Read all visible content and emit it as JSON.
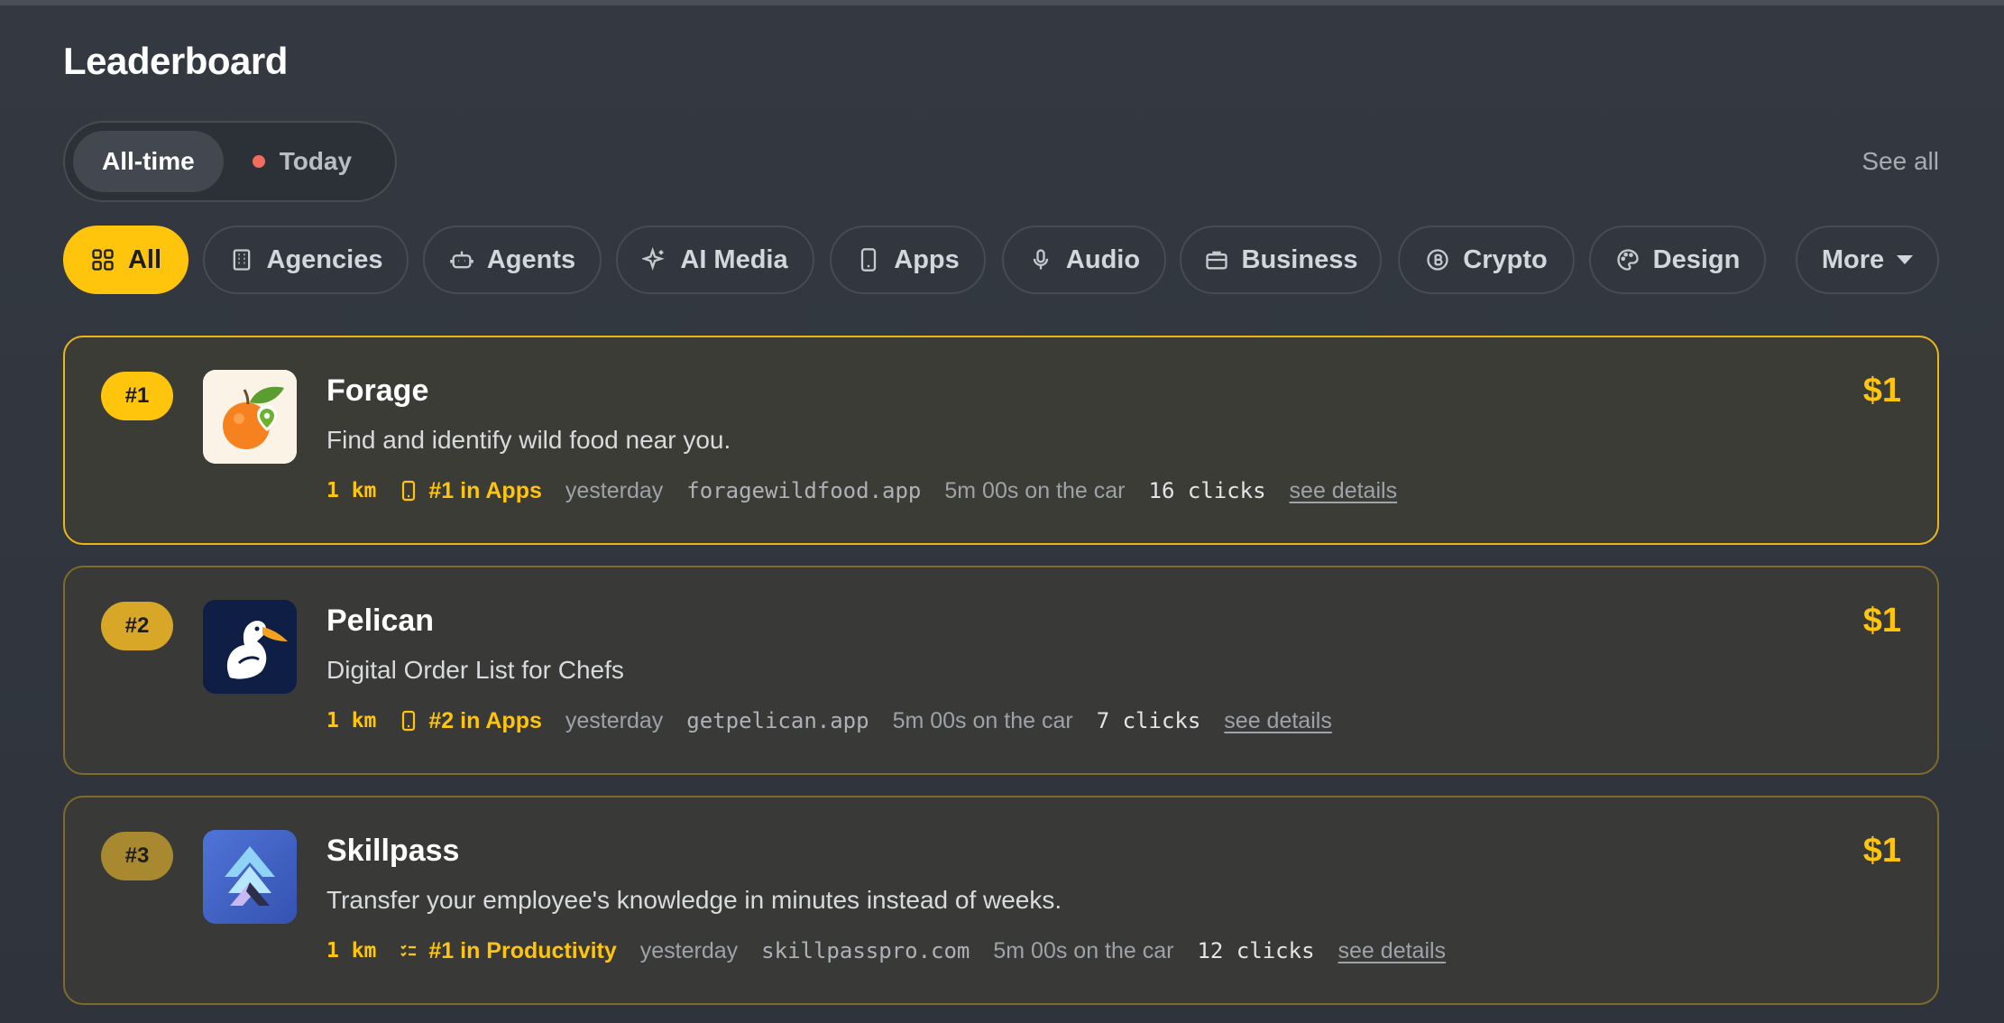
{
  "header": {
    "title": "Leaderboard",
    "see_all": "See all"
  },
  "timeframe": {
    "options": [
      "All-time",
      "Today"
    ],
    "selected": "All-time"
  },
  "categories": {
    "items": [
      {
        "label": "All",
        "icon": "grid-icon"
      },
      {
        "label": "Agencies",
        "icon": "building-icon"
      },
      {
        "label": "Agents",
        "icon": "robot-icon"
      },
      {
        "label": "AI Media",
        "icon": "sparkles-icon"
      },
      {
        "label": "Apps",
        "icon": "phone-icon"
      },
      {
        "label": "Audio",
        "icon": "microphone-icon"
      },
      {
        "label": "Business",
        "icon": "briefcase-icon"
      },
      {
        "label": "Crypto",
        "icon": "bitcoin-icon"
      },
      {
        "label": "Design",
        "icon": "palette-icon"
      }
    ],
    "more_label": "More",
    "selected": "All"
  },
  "entries": [
    {
      "rank": "#1",
      "name": "Forage",
      "description": "Find and identify wild food near you.",
      "distance": "1 km",
      "category_rank": "#1 in Apps",
      "category_icon": "phone-icon",
      "when": "yesterday",
      "domain": "foragewildfood.app",
      "duration": "5m 00s on the car",
      "clicks": "16 clicks",
      "details": "see details",
      "price": "$1",
      "logo": "orange-logo",
      "rank_color": "#ffc40c"
    },
    {
      "rank": "#2",
      "name": "Pelican",
      "description": "Digital Order List for Chefs",
      "distance": "1 km",
      "category_rank": "#2 in Apps",
      "category_icon": "phone-icon",
      "when": "yesterday",
      "domain": "getpelican.app",
      "duration": "5m 00s on the car",
      "clicks": "7 clicks",
      "details": "see details",
      "price": "$1",
      "logo": "pelican-logo",
      "rank_color": "#d8a728"
    },
    {
      "rank": "#3",
      "name": "Skillpass",
      "description": "Transfer your employee's knowledge in minutes instead of weeks.",
      "distance": "1 km",
      "category_rank": "#1 in Productivity",
      "category_icon": "checklist-icon",
      "when": "yesterday",
      "domain": "skillpasspro.com",
      "duration": "5m 00s on the car",
      "clicks": "12 clicks",
      "details": "see details",
      "price": "$1",
      "logo": "skillpass-logo",
      "rank_color": "#a8892f"
    }
  ],
  "colors": {
    "accent": "#ffc40c",
    "background": "#30353d",
    "live_dot": "#f26b5e"
  }
}
